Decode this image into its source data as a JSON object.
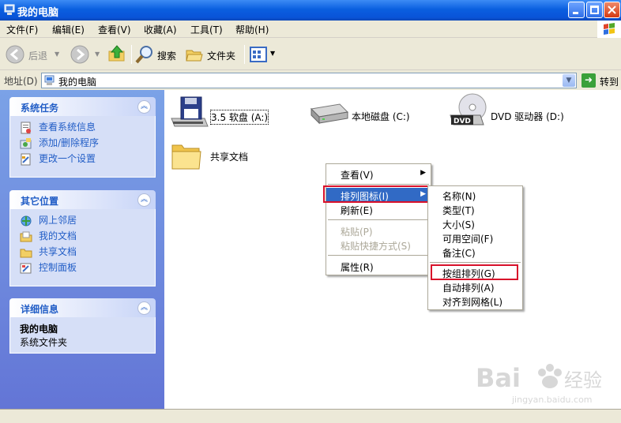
{
  "window": {
    "title": "我的电脑"
  },
  "menubar": [
    "文件(F)",
    "编辑(E)",
    "查看(V)",
    "收藏(A)",
    "工具(T)",
    "帮助(H)"
  ],
  "toolbar": {
    "back": "后退",
    "search": "搜索",
    "folders": "文件夹"
  },
  "address": {
    "label": "地址(D)",
    "value": "我的电脑",
    "go": "转到"
  },
  "tasks": {
    "title": "系统任务",
    "items": [
      {
        "label": "查看系统信息",
        "icon": "system-info-icon"
      },
      {
        "label": "添加/删除程序",
        "icon": "add-remove-programs-icon"
      },
      {
        "label": "更改一个设置",
        "icon": "control-settings-icon"
      }
    ]
  },
  "places": {
    "title": "其它位置",
    "items": [
      {
        "label": "网上邻居",
        "icon": "network-icon"
      },
      {
        "label": "我的文档",
        "icon": "documents-icon"
      },
      {
        "label": "共享文档",
        "icon": "shared-folder-icon"
      },
      {
        "label": "控制面板",
        "icon": "control-panel-icon"
      }
    ]
  },
  "details": {
    "title": "详细信息",
    "name": "我的电脑",
    "type": "系统文件夹"
  },
  "drives": [
    {
      "label": "3.5 软盘 (A:)",
      "icon": "floppy-drive-icon"
    },
    {
      "label": "本地磁盘 (C:)",
      "icon": "hard-disk-icon"
    },
    {
      "label": "DVD 驱动器 (D:)",
      "icon": "dvd-drive-icon"
    },
    {
      "label": "共享文档",
      "icon": "shared-docs-folder-icon"
    }
  ],
  "context_menu": {
    "items": [
      {
        "label": "查看(V)",
        "submenu": true
      },
      {
        "label": "排列图标(I)",
        "submenu": true,
        "highlighted": true
      },
      {
        "label": "刷新(E)"
      },
      {
        "label": "粘贴(P)",
        "disabled": true
      },
      {
        "label": "粘贴快捷方式(S)",
        "disabled": true
      },
      {
        "label": "属性(R)"
      }
    ]
  },
  "submenu": {
    "items": [
      {
        "label": "名称(N)"
      },
      {
        "label": "类型(T)"
      },
      {
        "label": "大小(S)"
      },
      {
        "label": "可用空间(F)"
      },
      {
        "label": "备注(C)"
      },
      {
        "label": "按组排列(G)",
        "boxed": true
      },
      {
        "label": "自动排列(A)"
      },
      {
        "label": "对齐到网格(L)"
      }
    ]
  },
  "watermark": {
    "brand": "Bai",
    "brand2": "经验",
    "url": "jingyan.baidu.com"
  }
}
